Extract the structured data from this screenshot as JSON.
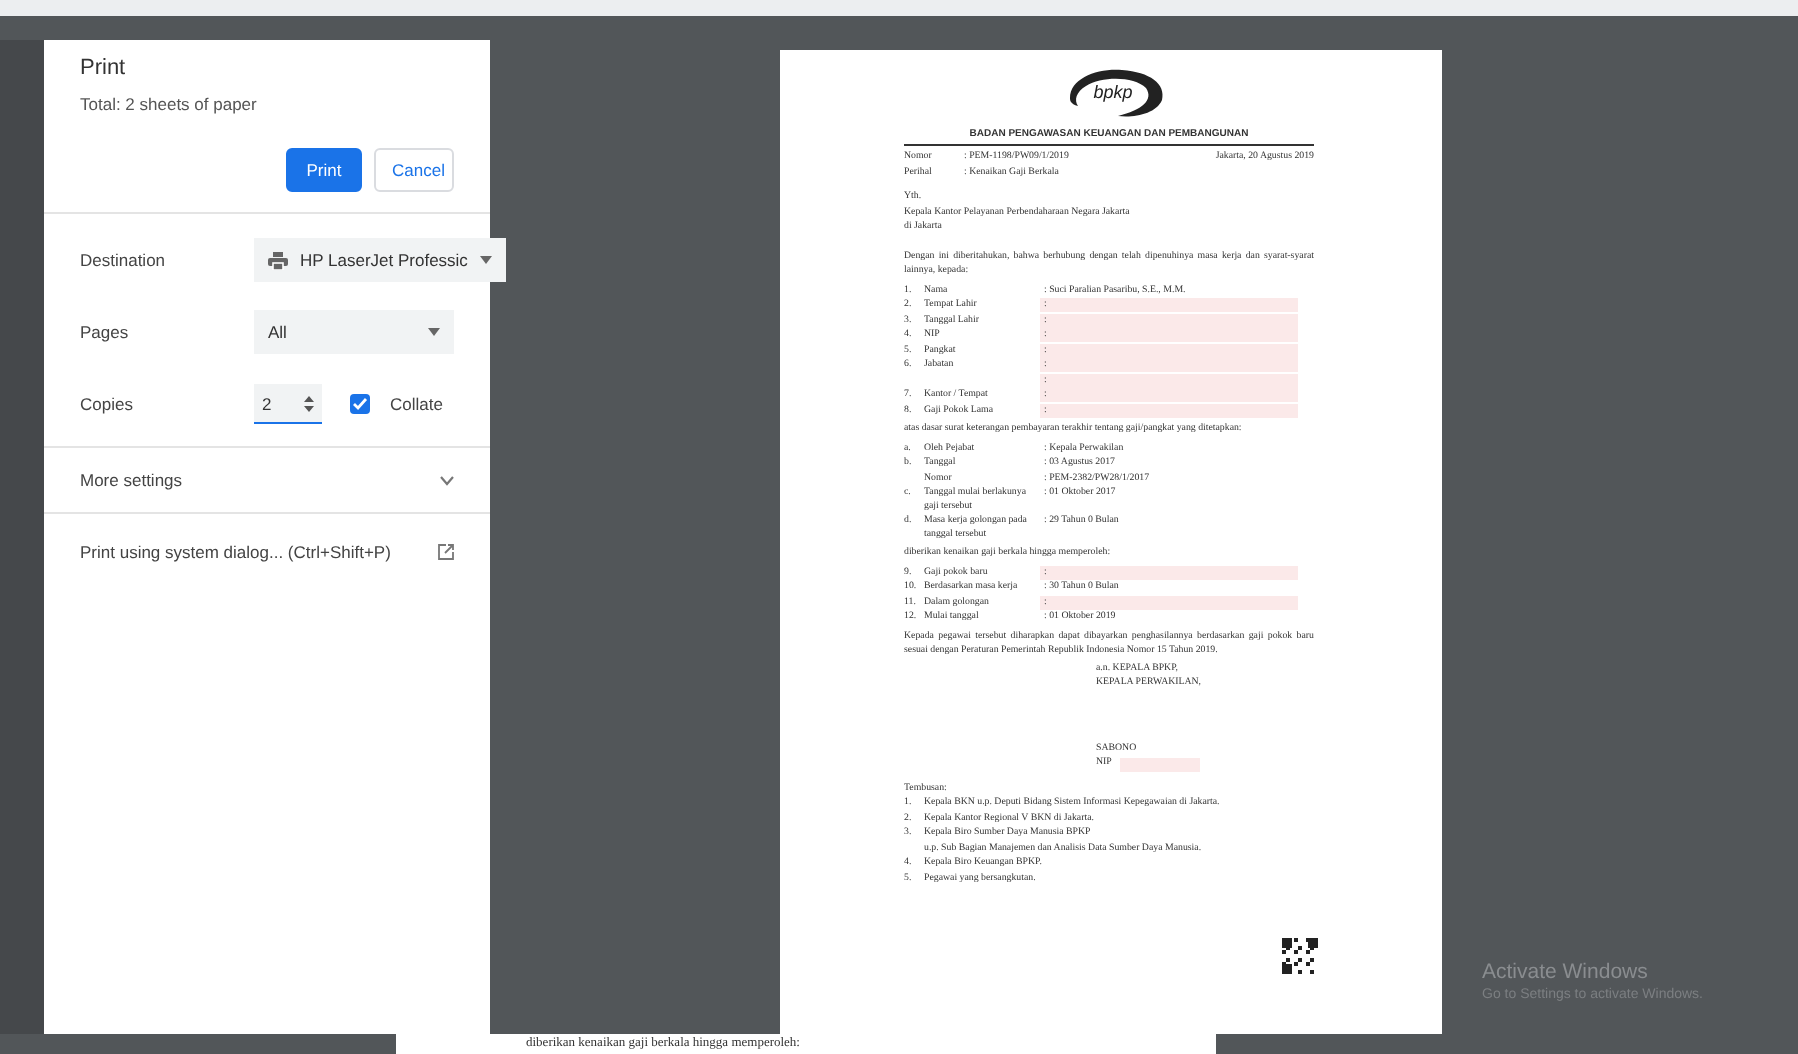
{
  "print_dialog": {
    "title": "Print",
    "summary": "Total: 2 sheets of paper",
    "buttons": [
      {
        "label": "Print",
        "kind": "primary"
      },
      {
        "label": "Cancel",
        "kind": "secondary"
      }
    ],
    "settings": [
      {
        "label": "Destination",
        "kind": "select",
        "value": "HP LaserJet Professic",
        "printer_icon": true
      },
      {
        "label": "Pages",
        "kind": "select",
        "value": "All"
      },
      {
        "label": "Copies",
        "kind": "number",
        "value": "2",
        "collate": {
          "label": "Collate",
          "checked": true
        }
      }
    ],
    "more_settings": {
      "label": "More settings",
      "expanded": false
    },
    "system_dialog": {
      "label": "Print using system dialog... (Ctrl+Shift+P)"
    }
  },
  "preview": {
    "document": {
      "logo": "bpkp",
      "agency": "BADAN PENGAWASAN KEUANGAN DAN PEMBANGUNAN",
      "blocks": [
        {
          "kind": "meta",
          "label": "Nomor",
          "value": ": PEM-1198/PW09/1/2019",
          "right": "Jakarta, 20 Agustus 2019"
        },
        {
          "kind": "meta",
          "label": "Perihal",
          "value": ": Kenaikan Gaji Berkala"
        },
        {
          "kind": "gap"
        },
        {
          "kind": "line",
          "text": "Yth."
        },
        {
          "kind": "line",
          "text": "Kepala Kantor Pelayanan Perbendaharaan Negara Jakarta"
        },
        {
          "kind": "line",
          "text": "di Jakarta"
        },
        {
          "kind": "gap"
        },
        {
          "kind": "para",
          "text": "Dengan ini diberitahukan, bahwa berhubung dengan telah dipenuhinya masa kerja dan syarat-syarat lainnya, kepada:"
        },
        {
          "kind": "item",
          "num": "1.",
          "label": "Nama",
          "value": ": Suci Paralian Pasaribu, S.E., M.M.",
          "redacted": false
        },
        {
          "kind": "item",
          "num": "2.",
          "label": "Tempat Lahir",
          "value": ":",
          "redacted": true
        },
        {
          "kind": "item",
          "num": "3.",
          "label": "Tanggal Lahir",
          "value": ":",
          "redacted": true
        },
        {
          "kind": "item",
          "num": "4.",
          "label": "NIP",
          "value": ":",
          "redacted": true
        },
        {
          "kind": "item",
          "num": "5.",
          "label": "Pangkat",
          "value": ":",
          "redacted": true
        },
        {
          "kind": "item",
          "num": "6.",
          "label": "Jabatan",
          "value": ":",
          "redacted": true
        },
        {
          "kind": "item",
          "value": ":",
          "redacted": true
        },
        {
          "kind": "item",
          "num": "7.",
          "label": "Kantor / Tempat",
          "value": ":",
          "redacted": true
        },
        {
          "kind": "item",
          "num": "8.",
          "label": "Gaji Pokok Lama",
          "value": ":",
          "redacted": true
        },
        {
          "kind": "para",
          "text": "atas dasar surat keterangan pembayaran terakhir tentang gaji/pangkat yang ditetapkan:"
        },
        {
          "kind": "item",
          "num": "a.",
          "label": "Oleh Pejabat",
          "value": ": Kepala Perwakilan",
          "redacted": false
        },
        {
          "kind": "item",
          "num": "b.",
          "label": "Tanggal",
          "value": ": 03 Agustus 2017",
          "redacted": false
        },
        {
          "kind": "item",
          "label": "Nomor",
          "value": ": PEM-2382/PW28/1/2017",
          "redacted": false
        },
        {
          "kind": "item",
          "num": "c.",
          "label": "Tanggal mulai berlakunya gaji tersebut",
          "value": ": 01 Oktober 2017",
          "redacted": false
        },
        {
          "kind": "item",
          "num": "d.",
          "label": "Masa kerja golongan pada tanggal tersebut",
          "value": ": 29 Tahun 0 Bulan",
          "redacted": false
        },
        {
          "kind": "para",
          "text": "diberikan kenaikan gaji berkala hingga memperoleh:"
        },
        {
          "kind": "item",
          "num": "9.",
          "label": "Gaji pokok baru",
          "value": ":",
          "redacted": true
        },
        {
          "kind": "item",
          "num": "10.",
          "label": "Berdasarkan masa kerja",
          "value": ": 30 Tahun 0 Bulan",
          "redacted": false
        },
        {
          "kind": "item",
          "num": "11.",
          "label": "Dalam golongan",
          "value": ":",
          "redacted": true
        },
        {
          "kind": "item",
          "num": "12.",
          "label": "Mulai tanggal",
          "value": ": 01 Oktober 2019",
          "redacted": false
        },
        {
          "kind": "para",
          "text": "Kepada pegawai tersebut diharapkan dapat dibayarkan penghasilannya berdasarkan gaji pokok baru sesuai dengan Peraturan Pemerintah Republik Indonesia Nomor 15 Tahun 2019."
        },
        {
          "kind": "sign",
          "text": "a.n. KEPALA BPKP,"
        },
        {
          "kind": "sign",
          "text": "KEPALA PERWAKILAN,"
        },
        {
          "kind": "space"
        },
        {
          "kind": "sign",
          "text": "SABONO"
        },
        {
          "kind": "sign",
          "text": "NIP",
          "redacted": true
        },
        {
          "kind": "gap"
        },
        {
          "kind": "line",
          "text": "Tembusan:"
        },
        {
          "kind": "item",
          "num": "1.",
          "label": "Kepala BKN u.p. Deputi Bidang Sistem Informasi Kepegawaian di Jakarta."
        },
        {
          "kind": "item",
          "num": "2.",
          "label": "Kepala Kantor Regional V BKN di Jakarta."
        },
        {
          "kind": "item",
          "num": "3.",
          "label": "Kepala Biro Sumber Daya Manusia BPKP"
        },
        {
          "kind": "item",
          "label": "u.p. Sub Bagian Manajemen dan Analisis Data Sumber Daya Manusia."
        },
        {
          "kind": "item",
          "num": "4.",
          "label": "Kepala Biro Keuangan BPKP."
        },
        {
          "kind": "item",
          "num": "5.",
          "label": "Pegawai yang bersangkutan."
        }
      ]
    }
  },
  "background_page": {
    "text": "diberikan kenaikan gaji berkala hingga memperoleh:"
  },
  "os_notice": {
    "title": "Activate Windows",
    "subtitle": "Go to Settings to activate Windows."
  }
}
